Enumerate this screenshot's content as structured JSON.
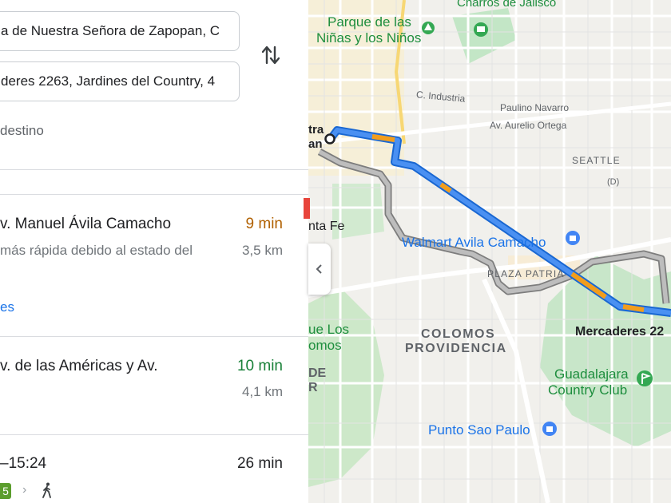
{
  "directions": {
    "origin_value": "a de Nuestra Señora de Zapopan, C",
    "destination_value": "deres 2263, Jardines del Country, 4",
    "add_destination": "destino"
  },
  "routes": [
    {
      "title": "v. Manuel Ávila Camacho",
      "time": "9 min",
      "time_color": "#b06000",
      "subtitle": "más rápida debido al estado del",
      "distance": "3,5 km",
      "link": "es"
    },
    {
      "title": "v. de las Américas y Av.",
      "time": "10 min",
      "time_color": "#188038",
      "subtitle": "",
      "distance": "4,1 km"
    },
    {
      "title": "–15:24",
      "time": "26 min",
      "time_color": "#202124",
      "badge": "5"
    }
  ],
  "map": {
    "labels": {
      "charros": "Charros de Jalisco",
      "parque_line1": "Parque de las",
      "parque_line2": "Niñas y los Niños",
      "industria": "C. Industria",
      "paulino": "Paulino Navarro",
      "aurelio": "Av. Aurelio Ortega",
      "seattle": "SEATTLE",
      "d_label": "(D)",
      "zapopan_a": "tra",
      "zapopan_b": "an",
      "santa_fe": "nta Fe",
      "walmart": "Walmart Avila Camacho",
      "plaza_patria": "PLAZA PATRIA",
      "colomos": "COLOMOS",
      "providencia": "PROVIDENCIA",
      "mercaderes": "Mercaderes 22",
      "los_colomos_1": "ue Los",
      "los_colomos_2": "omos",
      "de": "DE",
      "r": "R",
      "country_1": "Guadalajara",
      "country_2": "Country Club",
      "sao_paulo": "Punto Sao Paulo"
    }
  },
  "colors": {
    "route_blue": "#4285f4",
    "route_alt": "#9e9e9e",
    "traffic_orange": "#f29d1c",
    "park_green": "#c8e6c9"
  }
}
